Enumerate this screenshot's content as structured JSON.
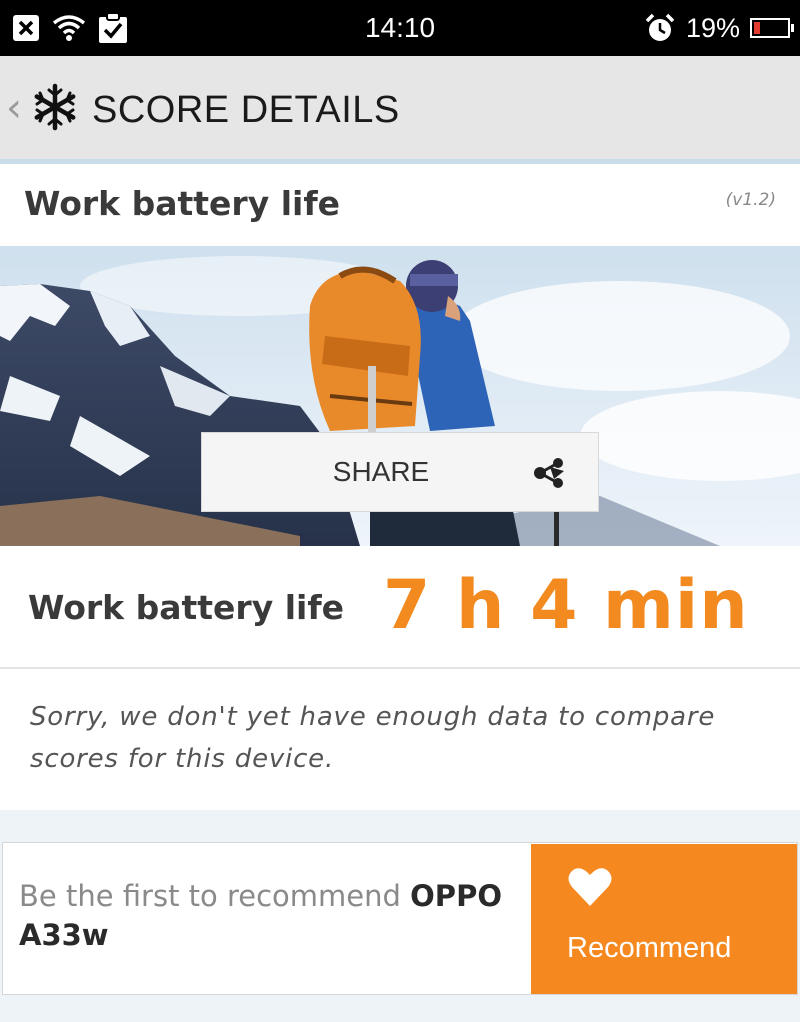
{
  "status_bar": {
    "time": "14:10",
    "battery_percent": "19%",
    "battery_level": 0.19,
    "icons": [
      "close-notification-icon",
      "wifi-icon",
      "clipboard-check-icon",
      "alarm-icon",
      "battery-icon"
    ]
  },
  "app_bar": {
    "title": "SCORE DETAILS",
    "back_glyph": "‹",
    "logo_icon": "snowflake-logo-icon"
  },
  "section": {
    "title": "Work battery life",
    "version": "(v1.2)"
  },
  "hero": {
    "share_label": "SHARE",
    "share_icon": "share-icon"
  },
  "result": {
    "label": "Work battery life",
    "value": "7 h 4 min",
    "note": "Sorry, we don't yet have enough data to compare scores for this device."
  },
  "recommend": {
    "prefix": "Be the first to recommend ",
    "device": "OPPO A33w",
    "button_label": "Recommend",
    "button_icon": "heart-icon"
  },
  "colors": {
    "accent_orange": "#f28a1f",
    "button_orange": "#f5891f",
    "status_bar": "#000000",
    "app_bar": "#e6e6e6"
  }
}
